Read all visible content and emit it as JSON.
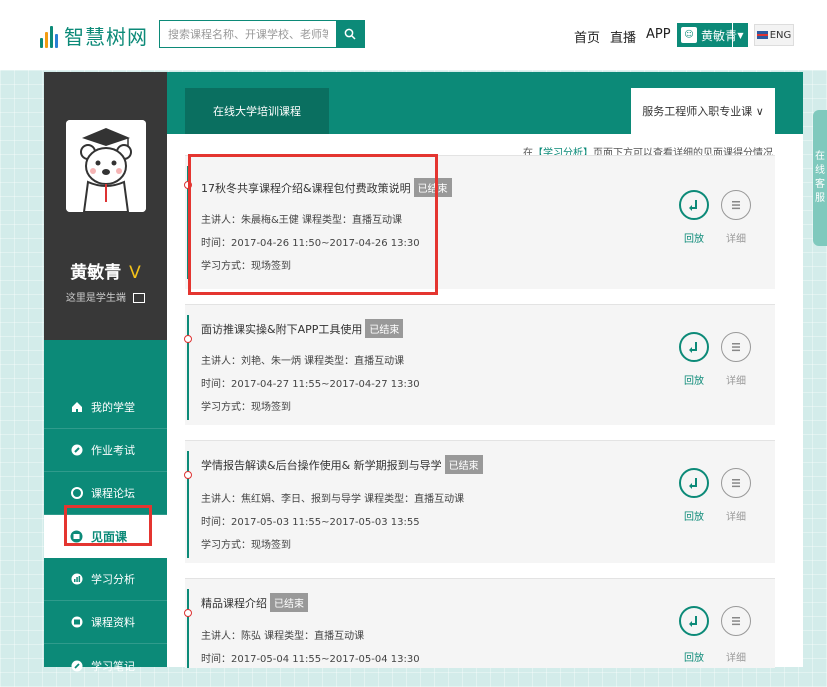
{
  "header": {
    "logo_text": "智慧树网",
    "search_placeholder": "搜索课程名称、开课学校、老师等",
    "nav": [
      "首页",
      "直播",
      "APP"
    ],
    "user_name": "黄敏青",
    "lang_label": "ENG"
  },
  "sidebar": {
    "user_name": "黄敏青",
    "level": "V",
    "motto": "这里是学生端",
    "menu": [
      {
        "label": "我的学堂",
        "icon": "home-icon"
      },
      {
        "label": "作业考试",
        "icon": "pencil-icon"
      },
      {
        "label": "课程论坛",
        "icon": "forum-icon"
      },
      {
        "label": "见面课",
        "icon": "meeting-icon"
      },
      {
        "label": "学习分析",
        "icon": "chart-icon"
      },
      {
        "label": "课程资料",
        "icon": "folder-icon"
      },
      {
        "label": "学习笔记",
        "icon": "note-icon"
      }
    ]
  },
  "tabs": {
    "left": "在线大学培训课程",
    "right": "服务工程师入职专业课 ∨"
  },
  "hint": {
    "prefix": "在",
    "link": "【学习分析】",
    "suffix": "页面下方可以查看详细的见面课得分情况"
  },
  "float_tab": [
    "在",
    "线",
    "客",
    "服"
  ],
  "sessions": [
    {
      "title": "17秋冬共享课程介绍&课程包付费政策说明",
      "status": "已结束",
      "speakers": "主讲人：朱晨梅&王健  课程类型：直播互动课",
      "time": "时间：2017-04-26 11:50~2017-04-26 13:30",
      "mode": "学习方式：现场签到"
    },
    {
      "title": "面访推课实操&附下APP工具使用",
      "status": "已结束",
      "speakers": "主讲人：刘艳、朱一炳  课程类型：直播互动课",
      "time": "时间：2017-04-27 11:55~2017-04-27 13:30",
      "mode": "学习方式：现场签到"
    },
    {
      "title": "学情报告解读&后台操作使用& 新学期报到与导学",
      "status": "已结束",
      "speakers": "主讲人：焦红娟、李日、报到与导学  课程类型：直播互动课",
      "time": "时间：2017-05-03 11:55~2017-05-03 13:55",
      "mode": "学习方式：现场签到"
    },
    {
      "title": "精品课程介绍",
      "status": "已结束",
      "speakers": "主讲人：陈弘  课程类型：直播互动课",
      "time": "时间：2017-05-04 11:55~2017-05-04 13:30",
      "mode": ""
    }
  ],
  "actions": {
    "replay": "回放",
    "detail": "详细"
  },
  "colors": {
    "brand": "#0c8a78",
    "highlight": "#e43530"
  }
}
